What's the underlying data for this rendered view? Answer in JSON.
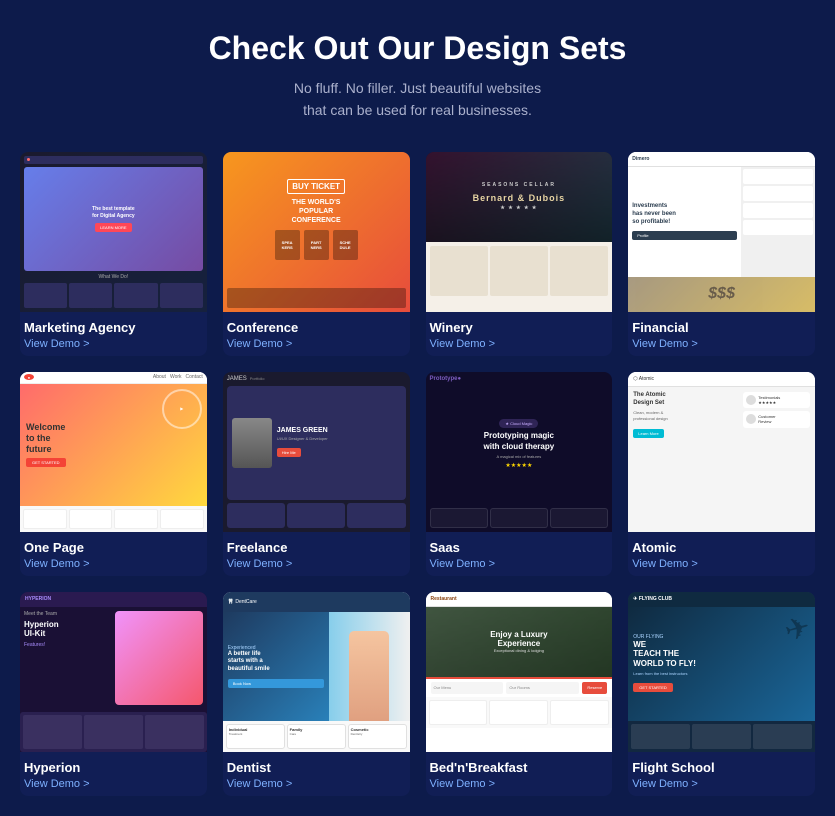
{
  "page": {
    "title": "Check Out Our Design Sets",
    "subtitle_line1": "No fluff. No filler. Just beautiful websites",
    "subtitle_line2": "that can be used for real businesses."
  },
  "cards": [
    {
      "id": "marketing",
      "title": "Marketing Agency",
      "link": "View Demo >"
    },
    {
      "id": "conference",
      "title": "Conference",
      "link": "View Demo >"
    },
    {
      "id": "winery",
      "title": "Winery",
      "link": "View Demo >"
    },
    {
      "id": "financial",
      "title": "Financial",
      "link": "View Demo >"
    },
    {
      "id": "onepage",
      "title": "One Page",
      "link": "View Demo >"
    },
    {
      "id": "freelance",
      "title": "Freelance",
      "link": "View Demo >"
    },
    {
      "id": "saas",
      "title": "Saas",
      "link": "View Demo >"
    },
    {
      "id": "atomic",
      "title": "Atomic",
      "link": "View Demo >"
    },
    {
      "id": "hyperion",
      "title": "Hyperion",
      "link": "View Demo >"
    },
    {
      "id": "dentist",
      "title": "Dentist",
      "link": "View Demo >"
    },
    {
      "id": "bnb",
      "title": "Bed'n'Breakfast",
      "link": "View Demo >"
    },
    {
      "id": "flight",
      "title": "Flight School",
      "link": "View Demo >"
    }
  ]
}
